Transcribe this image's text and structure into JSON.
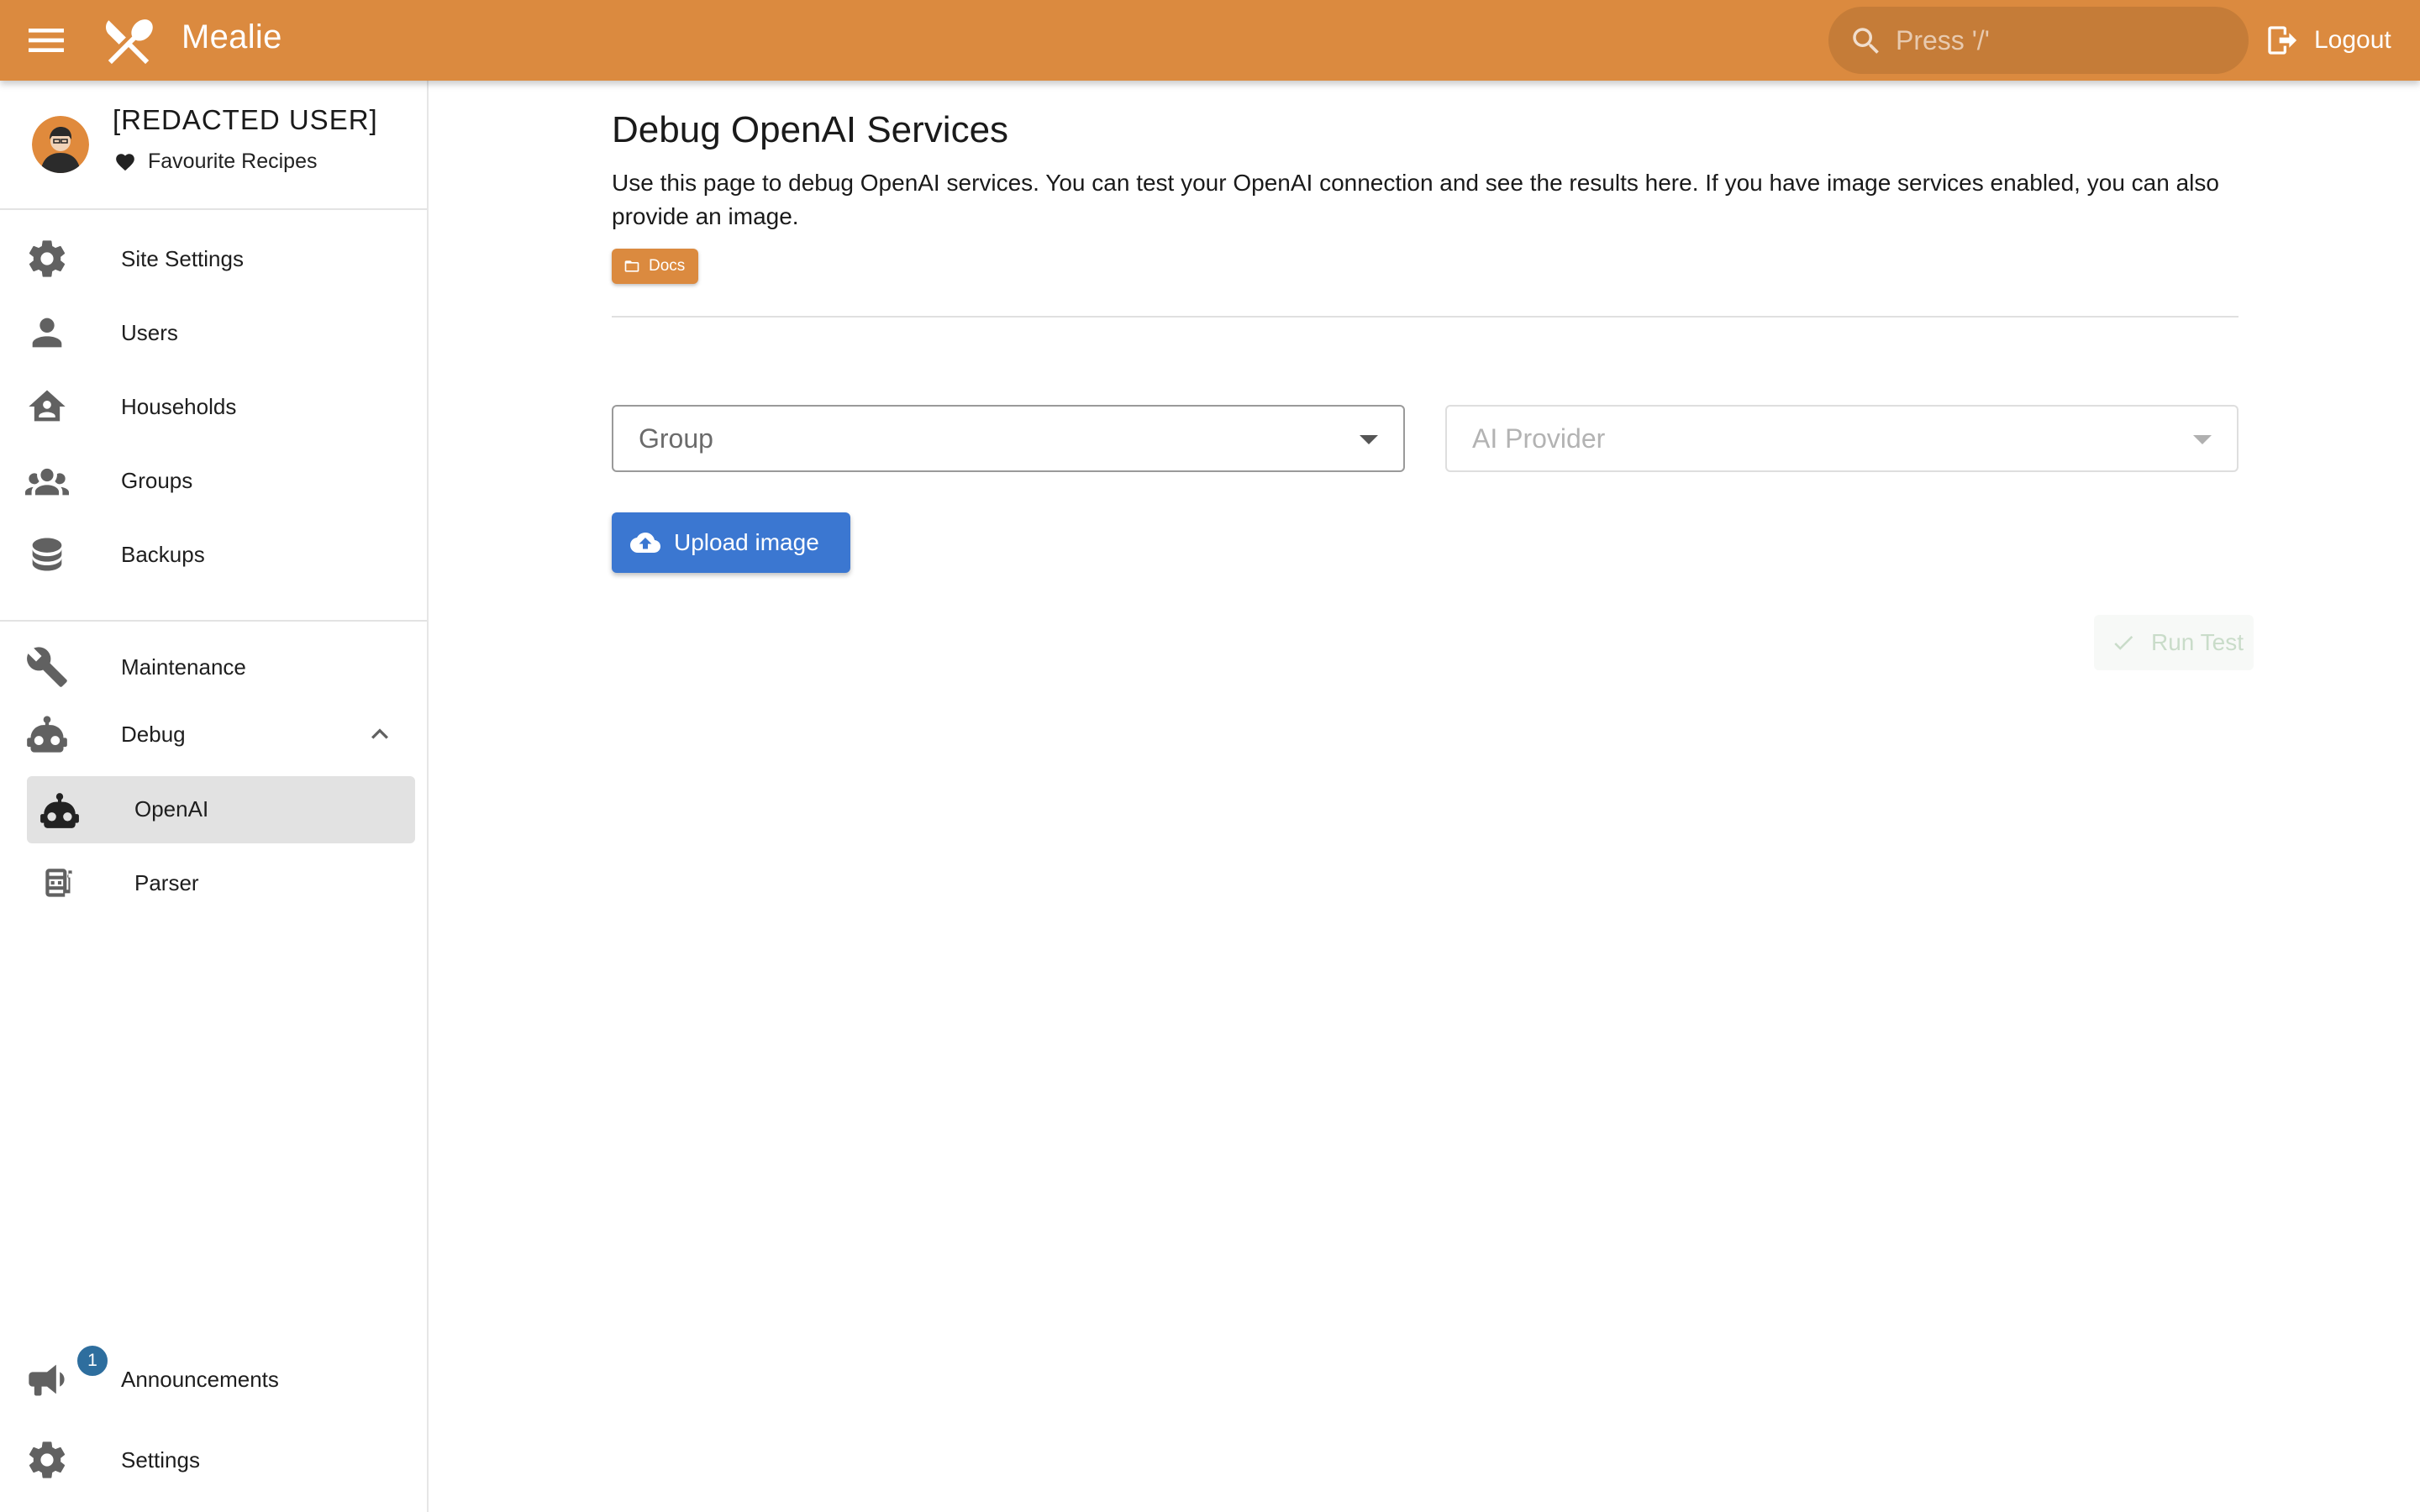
{
  "appbar": {
    "title": "Mealie",
    "search_placeholder": "Press '/'",
    "logout_label": "Logout",
    "color": "#DB8A3F"
  },
  "sidebar": {
    "user_name": "[REDACTED USER]",
    "favourites_label": "Favourite Recipes",
    "items": [
      {
        "label": "Site Settings",
        "icon": "gear-icon"
      },
      {
        "label": "Users",
        "icon": "person-icon"
      },
      {
        "label": "Households",
        "icon": "home-account-icon"
      },
      {
        "label": "Groups",
        "icon": "account-group-icon"
      },
      {
        "label": "Backups",
        "icon": "database-icon"
      }
    ],
    "maintenance_label": "Maintenance",
    "debug": {
      "label": "Debug",
      "expanded": true,
      "children": [
        {
          "label": "OpenAI",
          "icon": "robot-icon",
          "active": true
        },
        {
          "label": "Parser",
          "icon": "slot-machine-icon",
          "active": false
        }
      ]
    },
    "announcements": {
      "label": "Announcements",
      "badge_count": "1"
    },
    "settings_label": "Settings"
  },
  "main": {
    "title": "Debug OpenAI Services",
    "description": "Use this page to debug OpenAI services. You can test your OpenAI connection and see the results here. If you have image services enabled, you can also provide an image.",
    "docs_label": "Docs",
    "group_select": {
      "placeholder": "Group",
      "value": ""
    },
    "provider_select": {
      "placeholder": "AI Provider",
      "value": "",
      "disabled": true
    },
    "upload_label": "Upload image",
    "run_test_label": "Run Test",
    "accent_button_color": "#3B77D1"
  }
}
